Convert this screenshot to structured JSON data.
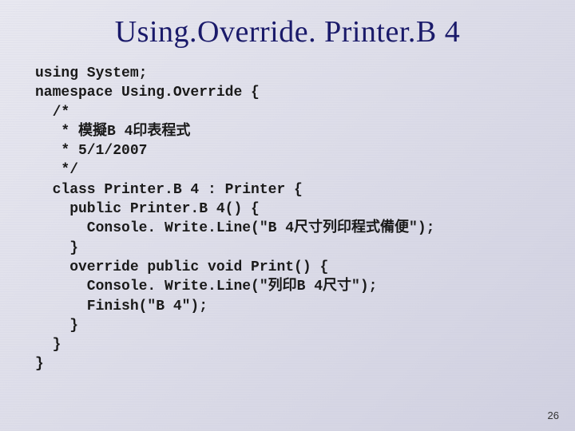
{
  "slide": {
    "title": "Using.Override. Printer.B 4",
    "page_number": "26"
  },
  "code": {
    "l01": "using System;",
    "l02": "namespace Using.Override {",
    "l03": "  /*",
    "l04": "   * 模擬B 4印表程式",
    "l05": "   * 5/1/2007",
    "l06": "   */",
    "l07": "  class Printer.B 4 : Printer {",
    "l08": "    public Printer.B 4() {",
    "l09": "      Console. Write.Line(\"B 4尺寸列印程式備便\");",
    "l10": "    }",
    "l11": "    override public void Print() {",
    "l12": "      Console. Write.Line(\"列印B 4尺寸\");",
    "l13": "      Finish(\"B 4\");",
    "l14": "    }",
    "l15": "  }",
    "l16": "}"
  }
}
